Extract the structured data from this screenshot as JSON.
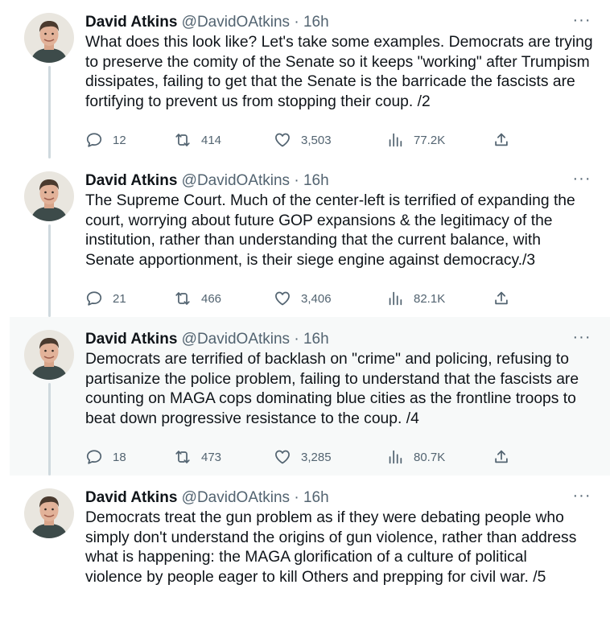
{
  "colors": {
    "text": "#0f1419",
    "secondary": "#536471",
    "thread_line": "#cfd9de",
    "highlight_bg": "#f7f9f9"
  },
  "icons": {
    "reply": "reply-icon",
    "retweet": "retweet-icon",
    "like": "heart-icon",
    "views": "views-icon",
    "share": "share-icon",
    "more": "more-icon"
  },
  "tweets": [
    {
      "name": "David Atkins",
      "handle": "@DavidOAtkins",
      "sep": "·",
      "time": "16h",
      "more": "···",
      "text": "What does this look like? Let's take some examples. Democrats are trying\nto preserve the comity of the Senate so it keeps \"working\" after Trumpism\ndissipates, failing to get that the Senate is the barricade the fascists are\nfortifying to prevent us from stopping their coup. /2",
      "replies": "12",
      "retweets": "414",
      "likes": "3,503",
      "views": "77.2K"
    },
    {
      "name": "David Atkins",
      "handle": "@DavidOAtkins",
      "sep": "·",
      "time": "16h",
      "more": "···",
      "text": "The Supreme Court. Much of the center-left is terrified of expanding the\ncourt, worrying about future GOP expansions & the legitimacy of the\ninstitution, rather than understanding that the current balance, with\nSenate apportionment, is their siege engine against democracy./3",
      "replies": "21",
      "retweets": "466",
      "likes": "3,406",
      "views": "82.1K"
    },
    {
      "name": "David Atkins",
      "handle": "@DavidOAtkins",
      "sep": "·",
      "time": "16h",
      "more": "···",
      "text": "Democrats are terrified of backlash on \"crime\" and policing, refusing to\npartisanize the police problem, failing to understand that the fascists are\ncounting on MAGA cops dominating blue cities as the frontline troops to\nbeat down progressive resistance to the coup. /4",
      "replies": "18",
      "retweets": "473",
      "likes": "3,285",
      "views": "80.7K"
    },
    {
      "name": "David Atkins",
      "handle": "@DavidOAtkins",
      "sep": "·",
      "time": "16h",
      "more": "···",
      "text": "Democrats treat the gun problem as if they were debating people who\nsimply don't understand the origins of gun violence, rather than address\nwhat is happening: the MAGA glorification of a culture of political\nviolence by people eager to kill Others and prepping for civil war. /5"
    }
  ]
}
